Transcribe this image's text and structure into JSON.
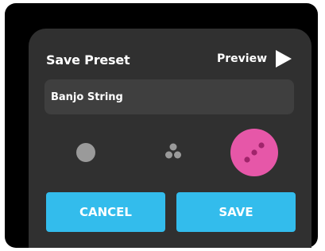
{
  "dialog": {
    "title": "Save Preset",
    "preview_label": "Preview",
    "preset_name_value": "Banjo String",
    "options": [
      {
        "name": "single-dot",
        "selected": false
      },
      {
        "name": "three-dots",
        "selected": false
      },
      {
        "name": "diagonal-dots",
        "selected": true
      }
    ],
    "cancel_label": "CANCEL",
    "save_label": "SAVE"
  },
  "colors": {
    "dialog_bg": "#303030",
    "field_bg": "#3f3f3f",
    "button": "#33bcec",
    "selected_option": "#e657a8",
    "dot_inactive": "#9a9a9a"
  }
}
